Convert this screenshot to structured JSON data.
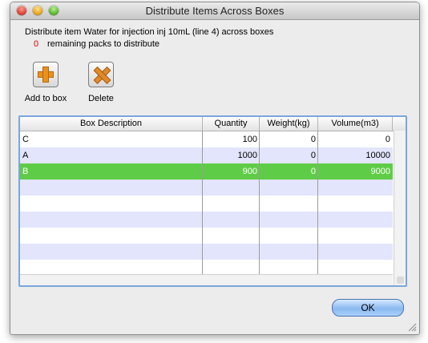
{
  "window": {
    "title": "Distribute Items Across Boxes"
  },
  "info": {
    "line1": "Distribute item Water for injection inj 10mL (line 4) across boxes",
    "remaining_count": "0",
    "remaining_label": "remaining packs to distribute"
  },
  "toolbar": {
    "add_label": "Add to box",
    "delete_label": "Delete"
  },
  "table": {
    "columns": [
      "Box Description",
      "Quantity",
      "Weight(kg)",
      "Volume(m3)"
    ],
    "rows": [
      {
        "desc": "C",
        "qty": "100",
        "weight": "0",
        "volume": "0"
      },
      {
        "desc": "A",
        "qty": "1000",
        "weight": "0",
        "volume": "10000"
      },
      {
        "desc": "B",
        "qty": "900",
        "weight": "0",
        "volume": "9000"
      }
    ],
    "selected_color": "#5fcc47",
    "alt_row_color": "#e2e5fb"
  },
  "buttons": {
    "ok_label": "OK"
  }
}
